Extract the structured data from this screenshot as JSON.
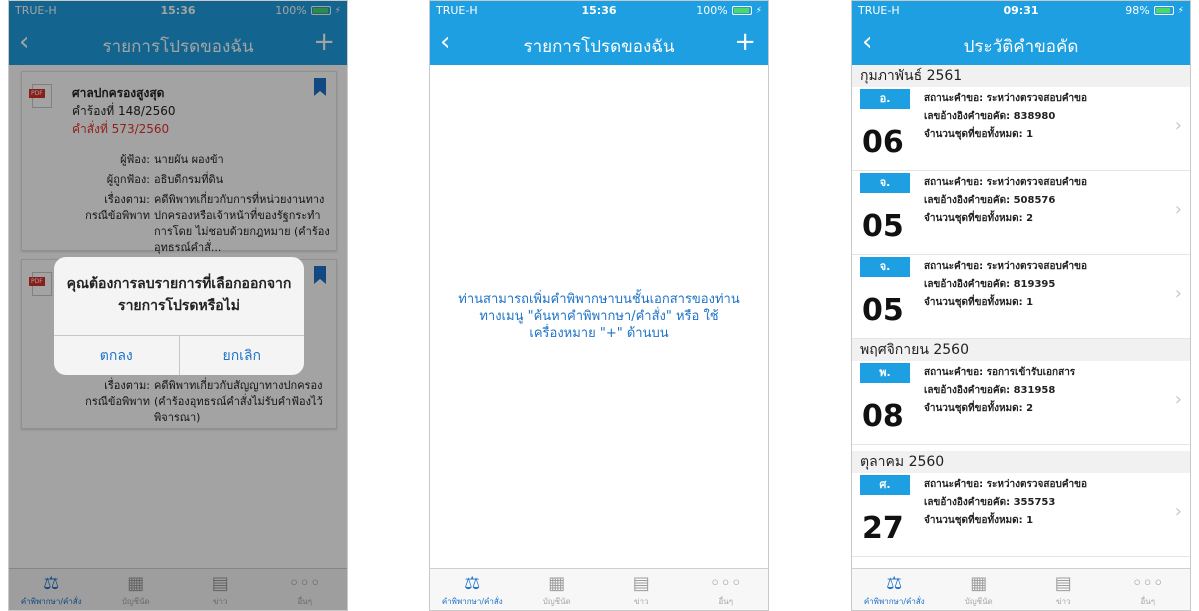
{
  "status_bar": [
    {
      "carrier": "TRUE-H",
      "time": "15:36",
      "battery": "100%"
    },
    {
      "carrier": "TRUE-H",
      "time": "15:36",
      "battery": "100%"
    },
    {
      "carrier": "TRUE-H",
      "time": "09:31",
      "battery": "98%"
    }
  ],
  "nav": {
    "back": "‹",
    "plus": "+",
    "favorites_title": "รายการโปรดของฉัน",
    "history_title": "ประวัติคำขอคัด"
  },
  "tabs": [
    {
      "label": "คำพิพากษา/คำสั่ง",
      "icon": "gavel-icon",
      "glyph": "⚖"
    },
    {
      "label": "บัญชีนัด",
      "icon": "calendar-icon",
      "glyph": "▦"
    },
    {
      "label": "ข่าว",
      "icon": "news-icon",
      "glyph": "▤"
    },
    {
      "label": "อื่นๆ",
      "icon": "more-icon",
      "glyph": "◦◦◦"
    }
  ],
  "favorites": [
    {
      "court": "ศาลปกครองสูงสุด",
      "request_no": "คำร้องที่  148/2560",
      "order_no": "คำสั่งที่  573/2560",
      "plaintiff_label": "ผู้ฟ้อง:",
      "plaintiff": "นายผัน ผองข้า",
      "defendant_label": "ผู้ถูกฟ้อง:",
      "defendant": "อธิบดีกรมที่ดิน",
      "subject_label": "เรื่องตาม:",
      "subject_label2": "กรณีข้อพิพาท",
      "subject": "คดีพิพาทเกี่ยวกับการที่หน่วยงานทาง ปกครองหรือเจ้าหน้าที่ของรัฐกระทำการโดย ไม่ชอบด้วยกฎหมาย (คำร้องอุทธรณ์คำสั่..."
    },
    {
      "subject_label": "เรื่องตาม:",
      "subject_label2": "กรณีข้อพิพาท",
      "subject": "คดีพิพาทเกี่ยวกับสัญญาทางปกครอง (คำร้องอุทธรณ์คำสั่งไม่รับคำฟ้องไว้พิจารณา)"
    }
  ],
  "dialog": {
    "message": "คุณต้องการลบรายการที่เลือกออกจากรายการโปรดหรือไม่",
    "ok": "ตกลง",
    "cancel": "ยกเลิก"
  },
  "empty_message": "ท่านสามารถเพิ่มคำพิพากษาบนชั้นเอกสารของท่านทางเมนู \"ค้นหาคำพิพากษา/คำสั่ง\" หรือ ใช้เครื่องหมาย \"+\" ด้านบน",
  "history": {
    "months": [
      "กุมภาพันธ์ 2561",
      "พฤศจิกายน 2560",
      "ตุลาคม 2560"
    ],
    "requests": [
      {
        "dow": "อ.",
        "day": "06",
        "status": "สถานะคำขอ: ระหว่างตรวจสอบคำขอ",
        "ref": "เลขอ้างอิงคำขอคัด: 838980",
        "sets": "จำนวนชุดที่ขอทั้งหมด: 1"
      },
      {
        "dow": "จ.",
        "day": "05",
        "status": "สถานะคำขอ: ระหว่างตรวจสอบคำขอ",
        "ref": "เลขอ้างอิงคำขอคัด: 508576",
        "sets": "จำนวนชุดที่ขอทั้งหมด: 2"
      },
      {
        "dow": "จ.",
        "day": "05",
        "status": "สถานะคำขอ: ระหว่างตรวจสอบคำขอ",
        "ref": "เลขอ้างอิงคำขอคัด: 819395",
        "sets": "จำนวนชุดที่ขอทั้งหมด: 1"
      },
      {
        "dow": "พ.",
        "day": "08",
        "status": "สถานะคำขอ: รอการเข้ารับเอกสาร",
        "ref": "เลขอ้างอิงคำขอคัด: 831958",
        "sets": "จำนวนชุดที่ขอทั้งหมด: 2"
      },
      {
        "dow": "ศ.",
        "day": "27",
        "status": "สถานะคำขอ: ระหว่างตรวจสอบคำขอ",
        "ref": "เลขอ้างอิงคำขอคัด: 355753",
        "sets": "จำนวนชุดที่ขอทั้งหมด: 1"
      }
    ]
  }
}
